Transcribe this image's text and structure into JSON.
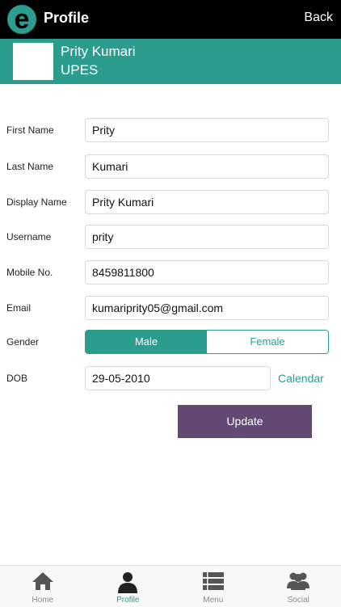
{
  "header": {
    "title": "Profile",
    "back_label": "Back",
    "logo_letter": "e",
    "logo_color": "#2a9d8f"
  },
  "profile": {
    "name": "Prity Kumari",
    "organization": "UPES"
  },
  "form": {
    "first_name": {
      "label": "First Name",
      "value": "Prity"
    },
    "last_name": {
      "label": "Last Name",
      "value": "Kumari"
    },
    "display_name": {
      "label": "Display Name",
      "value": "Prity Kumari"
    },
    "username": {
      "label": "Username",
      "value": "prity"
    },
    "mobile": {
      "label": "Mobile No.",
      "value": "8459811800"
    },
    "email": {
      "label": "Email",
      "value": "kumariprity05@gmail.com"
    },
    "gender": {
      "label": "Gender",
      "options": [
        "Male",
        "Female"
      ],
      "selected": "Male"
    },
    "dob": {
      "label": "DOB",
      "value": "29-05-2010",
      "calendar_label": "Calendar"
    },
    "update_label": "Update"
  },
  "tabs": [
    {
      "label": "Home",
      "icon": "home-icon"
    },
    {
      "label": "Profile",
      "icon": "user-icon",
      "active": true
    },
    {
      "label": "Menu",
      "icon": "menu-icon"
    },
    {
      "label": "Social",
      "icon": "group-icon"
    }
  ],
  "colors": {
    "accent": "#2a9d8f",
    "update_button": "#634a75",
    "header_bg": "#000000"
  }
}
